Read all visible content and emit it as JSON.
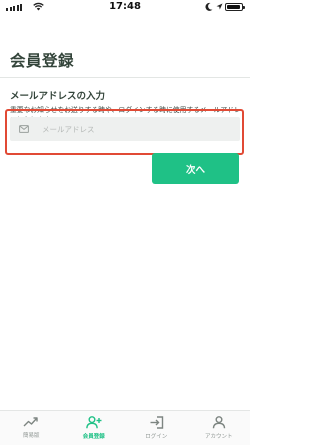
{
  "status_bar": {
    "time": "17:48"
  },
  "page": {
    "title": "会員登録"
  },
  "section": {
    "title": "メールアドレスの入力",
    "description": "重要なお知らせをお送りする時や、ログインする時に使用するメールアドレスとなります。"
  },
  "email_input": {
    "placeholder": "メールアドレス",
    "value": ""
  },
  "next_button": {
    "label": "次へ"
  },
  "tabs": [
    {
      "label": "簡易版",
      "icon": "trend-chart-icon",
      "active": false
    },
    {
      "label": "会員登録",
      "icon": "add-user-icon",
      "active": true
    },
    {
      "label": "ログイン",
      "icon": "login-icon",
      "active": false
    },
    {
      "label": "アカウント",
      "icon": "account-icon",
      "active": false
    }
  ],
  "colors": {
    "accent": "#1fc186",
    "highlight_border": "#e14a35",
    "title_text": "#33443a",
    "input_background": "#eef0ef"
  }
}
